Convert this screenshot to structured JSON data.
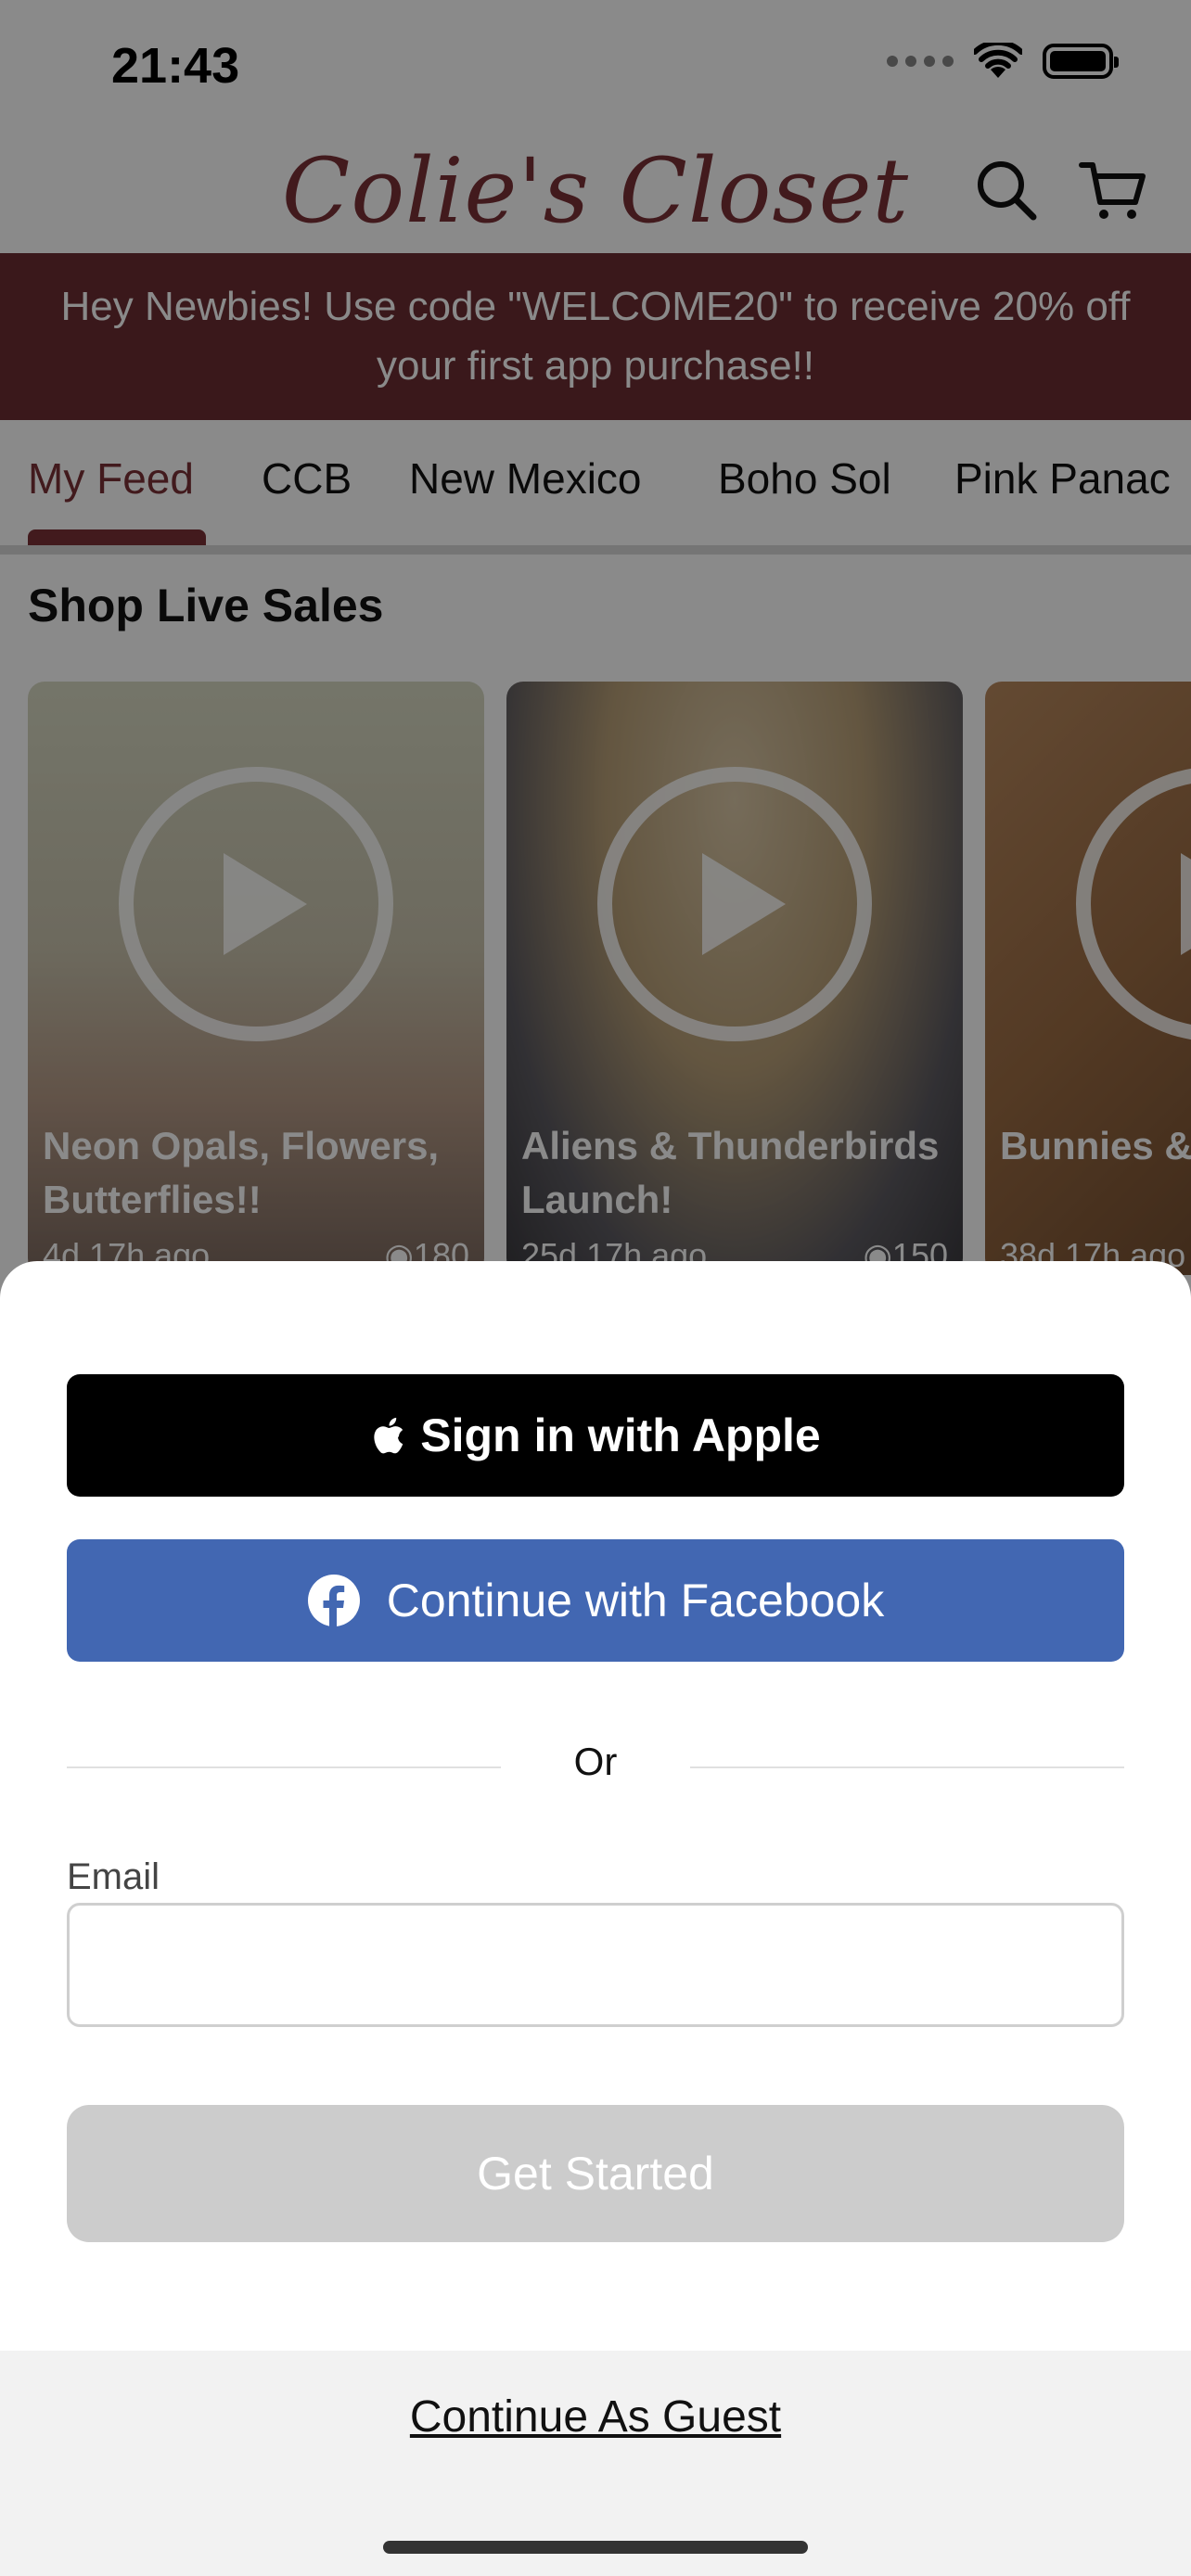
{
  "status_bar": {
    "time": "21:43"
  },
  "header": {
    "logo_text": "Colie's Closet"
  },
  "promo_banner": {
    "text": "Hey Newbies! Use code \"WELCOME20\" to receive 20% off your first app purchase!!"
  },
  "tabs": [
    {
      "label": "My Feed",
      "active": true
    },
    {
      "label": "CCB"
    },
    {
      "label": "New Mexico"
    },
    {
      "label": "Boho Sol"
    },
    {
      "label": "Pink Panac"
    }
  ],
  "section": {
    "title": "Shop Live Sales"
  },
  "live_sales": [
    {
      "title": "Neon Opals, Flowers, Butterflies!!",
      "age": "4d 17h ago",
      "views": "180"
    },
    {
      "title": "Aliens & Thunderbirds Launch!",
      "age": "25d 17h ago",
      "views": "150"
    },
    {
      "title": "Bunnies & Markdown",
      "age": "38d 17h ago",
      "views": ""
    }
  ],
  "auth_sheet": {
    "apple_label": "Sign in with Apple",
    "facebook_label": "Continue with Facebook",
    "or_label": "Or",
    "email_label": "Email",
    "email_value": "",
    "email_placeholder": "",
    "get_started_label": "Get Started",
    "guest_label": "Continue As Guest"
  },
  "colors": {
    "brand": "#7a3136",
    "promo_bg": "#6b2e33",
    "facebook": "#4267b2",
    "apple": "#000000",
    "disabled_button": "#cccccc"
  }
}
